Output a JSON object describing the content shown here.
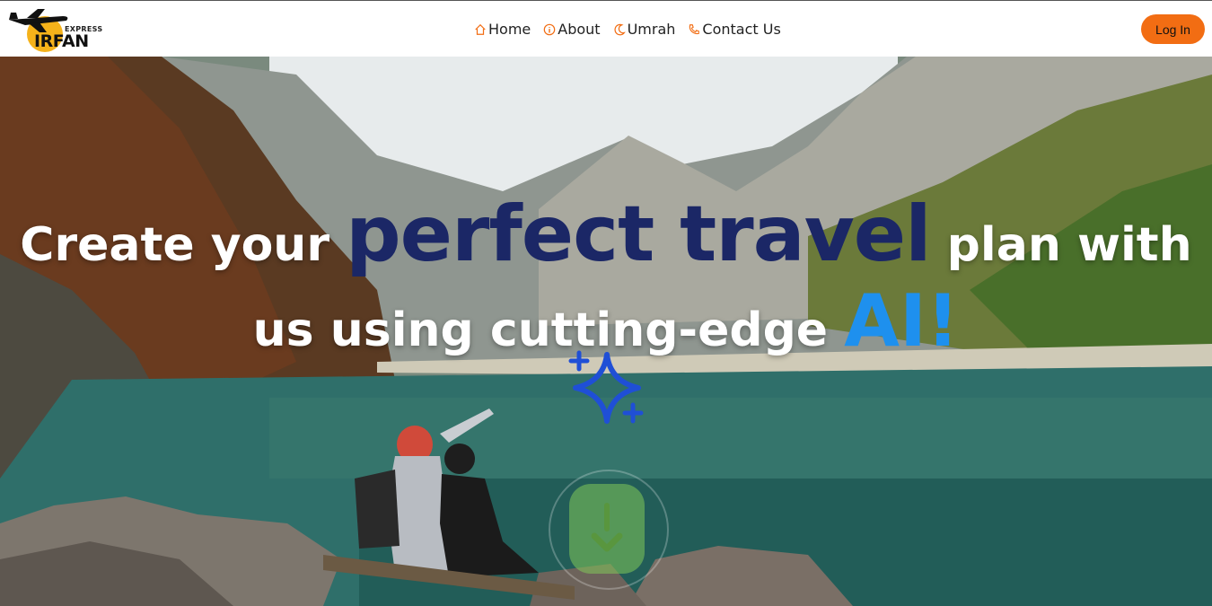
{
  "brand": {
    "express": "EXPRESS",
    "name": "IRFAN"
  },
  "nav": {
    "items": [
      {
        "label": "Home",
        "icon": "home-icon"
      },
      {
        "label": "About",
        "icon": "info-icon"
      },
      {
        "label": "Umrah",
        "icon": "crescent-icon"
      },
      {
        "label": "Contact Us",
        "icon": "phone-icon"
      }
    ],
    "login_label": "Log In"
  },
  "hero": {
    "line1_start": "Create your ",
    "line1_highlight": "perfect travel",
    "line1_end": " plan with",
    "line2_start": "us using cutting-edge ",
    "line2_highlight": "AI!",
    "sparkle_icon": "sparkle-icon",
    "scroll_icon": "scroll-down-icon"
  },
  "colors": {
    "accent": "#f26d13",
    "headline_dark": "#1b2766",
    "headline_blue": "#1e90ee",
    "sparkle": "#1f4fd6"
  }
}
